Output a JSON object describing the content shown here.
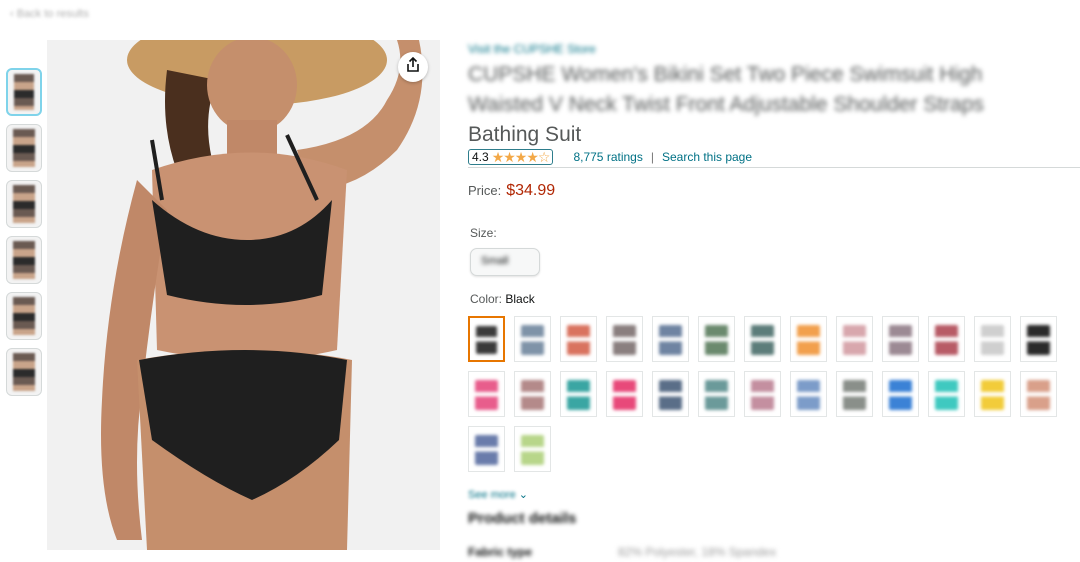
{
  "breadcrumb": "‹ Back to results",
  "product": {
    "store_link": "Visit the CUPSHE Store",
    "title_line1": "CUPSHE Women's Bikini Set Two Piece Swimsuit High",
    "title_line2": "Waisted V Neck Twist Front Adjustable Shoulder Straps",
    "title_line3": "Bathing Suit",
    "rating_value": "4.3",
    "stars": "★★★★☆",
    "ratings_count": "8,775 ratings",
    "separator": "|",
    "search_link": "Search this page",
    "price_label": "Price:",
    "price_value": "$34.99",
    "size_label": "Size:",
    "size_selected": "Small",
    "color_label": "Color:",
    "color_selected": "Black",
    "more_link": "See more",
    "details_heading": "Product details",
    "fabric_label": "Fabric type",
    "fabric_value": "82% Polyester, 18% Spandex"
  },
  "colors": {
    "accent_link": "#007185",
    "price": "#b12704",
    "star": "#f3a847",
    "selected_border": "#e77600"
  },
  "swatch_colors": [
    "#3a3a3a",
    "#7f93a8",
    "#d9735f",
    "#8a7f7f",
    "#6f84a2",
    "#6b8a6e",
    "#5c7d7a",
    "#f2a04d",
    "#d8a7ad",
    "#9c8a94",
    "#b85b66",
    "#cfcfcf",
    "#2a2a2a",
    "#e85d8c",
    "#b48a8a",
    "#3aa6a3",
    "#e8497a",
    "#5a6e88",
    "#6b9a9a",
    "#c48fa0",
    "#7c9cc9",
    "#8a8f8a",
    "#3b82d6",
    "#3fc9c0",
    "#f2cc3a",
    "#d9a08a",
    "#6a7cab",
    "#b8d68a"
  ]
}
